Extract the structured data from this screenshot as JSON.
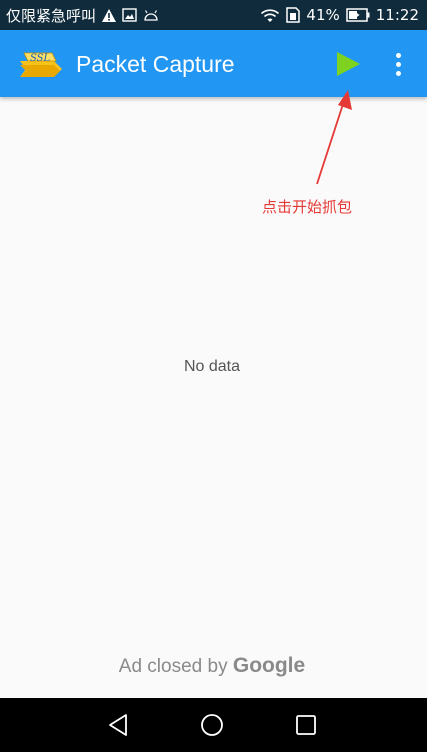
{
  "status_bar": {
    "carrier": "仅限紧急呼叫",
    "battery": "41%",
    "time": "11:22",
    "icons": [
      "warning-icon",
      "image-icon",
      "android-icon",
      "wifi-icon",
      "sim-icon",
      "battery-icon"
    ]
  },
  "app_bar": {
    "title": "Packet Capture",
    "logo_text": "SSL",
    "color": "#2196f3",
    "actions": [
      "play-icon",
      "more-vert-icon"
    ]
  },
  "annotation": {
    "text": "点击开始抓包",
    "color": "#e53935"
  },
  "main": {
    "empty_text": "No data"
  },
  "ad": {
    "prefix": "Ad closed by",
    "brand": "Google"
  },
  "nav_bar": {
    "buttons": [
      "back-icon",
      "home-icon",
      "recents-icon"
    ]
  }
}
